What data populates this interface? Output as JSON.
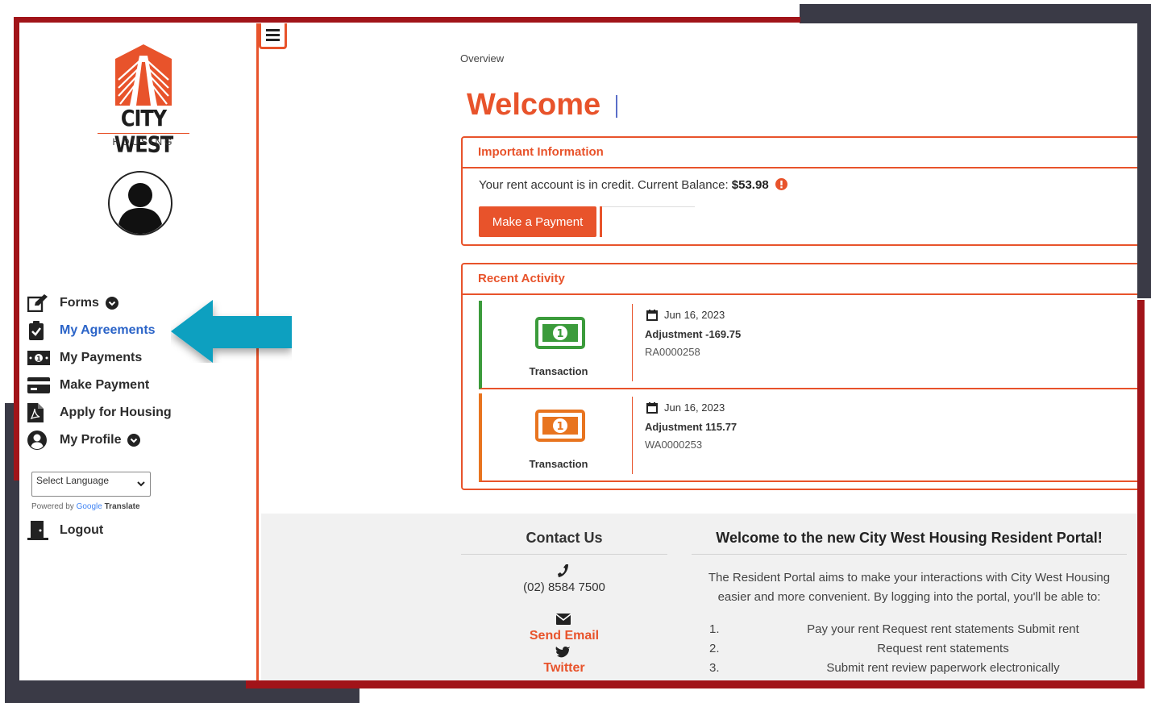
{
  "brand": {
    "name": "CITY WEST",
    "tagline": "HOUSING",
    "accent_color": "#e8532b",
    "frame_color": "#a11419",
    "link_active_color": "#2b64c8",
    "logo_icon": "city-west-logo-icon"
  },
  "sidebar": {
    "avatar_icon": "user-avatar-icon",
    "items": [
      {
        "label": "Forms",
        "icon": "edit-icon",
        "dropdown": true
      },
      {
        "label": "My Agreements",
        "icon": "clipboard-check-icon",
        "active": true
      },
      {
        "label": "My Payments",
        "icon": "money-bill-icon"
      },
      {
        "label": "Make Payment",
        "icon": "credit-card-icon"
      },
      {
        "label": "Apply for Housing",
        "icon": "file-pdf-icon"
      },
      {
        "label": "My Profile",
        "icon": "user-circle-icon",
        "dropdown": true
      }
    ],
    "language_select": "Select Language",
    "powered_by": "Powered by",
    "google": "Google",
    "translate": "Translate",
    "logout": "Logout"
  },
  "main": {
    "breadcrumb": "Overview",
    "title": "Welcome",
    "important": {
      "heading": "Important Information",
      "text": "Your rent account is in credit. Current Balance:",
      "balance": "$53.98",
      "button": "Make a Payment"
    },
    "activity": {
      "heading": "Recent Activity",
      "items": [
        {
          "type": "Transaction",
          "date": "Jun 16, 2023",
          "amount": "Adjustment -169.75",
          "ref": "RA0000258",
          "color": "#3b9b3b"
        },
        {
          "type": "Transaction",
          "date": "Jun 16, 2023",
          "amount": "Adjustment 115.77",
          "ref": "WA0000253",
          "color": "#e8741f"
        }
      ]
    }
  },
  "footer": {
    "contact_title": "Contact Us",
    "phone": "(02) 8584 7500",
    "email": "Send Email",
    "twitter": "Twitter",
    "welcome_title": "Welcome to the new City West Housing Resident Portal!",
    "welcome_text": "The Resident Portal aims to make your interactions with City West Housing easier and more convenient. By logging into the portal, you'll be able to:",
    "list": [
      {
        "num": "1.",
        "text": "Pay your rent Request rent statements Submit rent"
      },
      {
        "num": "2.",
        "text": "Request rent statements"
      },
      {
        "num": "3.",
        "text": "Submit rent review paperwork electronically"
      }
    ]
  }
}
